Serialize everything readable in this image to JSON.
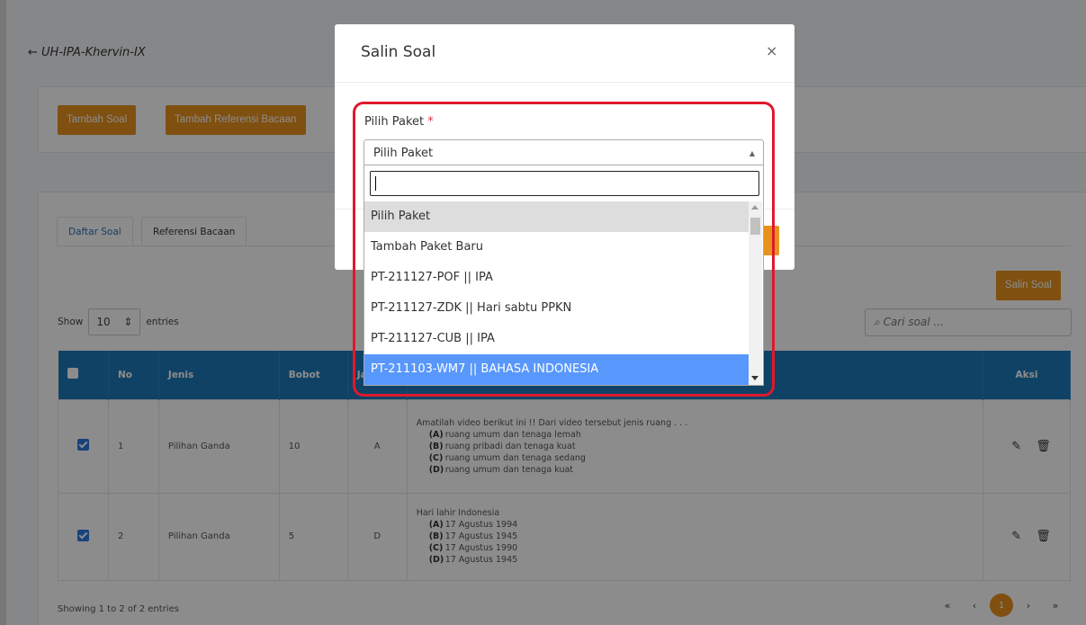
{
  "page": {
    "back_title": "UH-IPA-Khervin-IX",
    "buttons": {
      "tambah_soal": "Tambah Soal",
      "tambah_referensi": "Tambah Referensi Bacaan",
      "salin_soal": "Salin Soal"
    },
    "tabs": [
      {
        "label": "Daftar Soal"
      },
      {
        "label": "Referensi Bacaan"
      }
    ],
    "show_label": "Show",
    "entries_value": "10",
    "entries_label": "entries",
    "search_placeholder": "Cari soal ...",
    "table": {
      "headers": [
        "No",
        "Jenis",
        "Bobot",
        "Ja",
        "",
        "Aksi"
      ],
      "rows": [
        {
          "no": "1",
          "jenis": "Pilihan Ganda",
          "bobot": "10",
          "jawaban": "A",
          "question": "Amatilah video berikut ini !!   Dari video tersebut jenis ruang . . .",
          "options": [
            {
              "key": "(A)",
              "text": "ruang umum dan tenaga lemah"
            },
            {
              "key": "(B)",
              "text": "ruang pribadi dan tenaga kuat"
            },
            {
              "key": "(C)",
              "text": "ruang umum dan tenaga sedang"
            },
            {
              "key": "(D)",
              "text": "ruang umum dan tenaga kuat"
            }
          ]
        },
        {
          "no": "2",
          "jenis": "Pilihan Ganda",
          "bobot": "5",
          "jawaban": "D",
          "question": "Hari lahir Indonesia",
          "options": [
            {
              "key": "(A)",
              "text": "17 Agustus 1994"
            },
            {
              "key": "(B)",
              "text": "17 Agustus 1945"
            },
            {
              "key": "(C)",
              "text": "17 Agustus 1990"
            },
            {
              "key": "(D)",
              "text": "17 Agustus 1945"
            }
          ]
        }
      ]
    },
    "showing_text": "Showing 1 to 2 of 2 entries",
    "pager": {
      "first": "«",
      "prev": "‹",
      "current": "1",
      "next": "›",
      "last": "»"
    }
  },
  "modal": {
    "title": "Salin Soal",
    "close": "×",
    "field_label": "Pilih Paket",
    "required_mark": "*",
    "selected_value": "Pilih Paket",
    "dropdown_options": [
      "Pilih Paket",
      "Tambah Paket Baru",
      "PT-211127-POF || IPA",
      "PT-211127-ZDK || Hari sabtu PPKN",
      "PT-211127-CUB || IPA",
      "PT-211103-WM7 || BAHASA INDONESIA"
    ]
  },
  "colors": {
    "accent": "#e8921e",
    "table_header": "#1e79b8",
    "highlight": "#5897fb",
    "outline": "#e0182c"
  }
}
